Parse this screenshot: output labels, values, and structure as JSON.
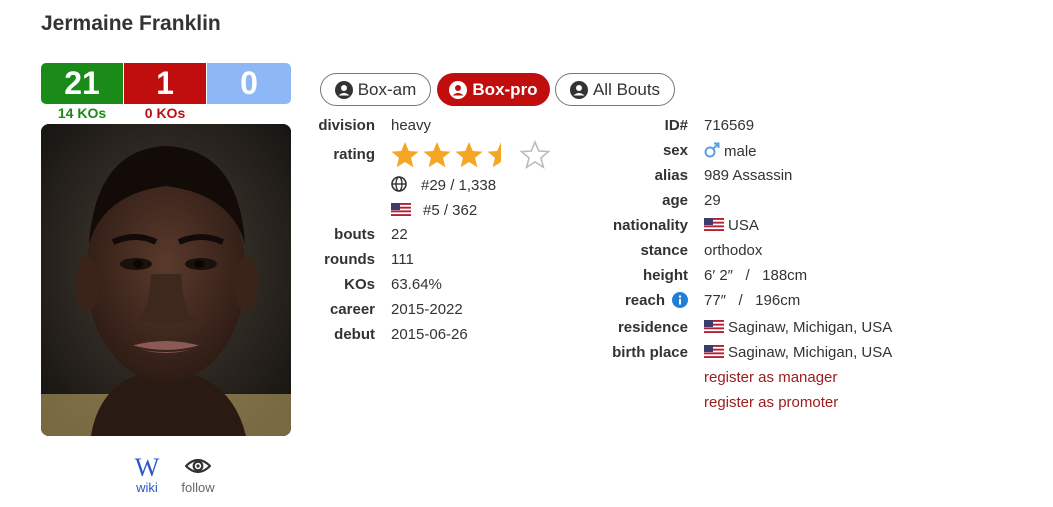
{
  "boxer": {
    "name": "Jermaine Franklin",
    "record": {
      "wins": "21",
      "losses": "1",
      "draws": "0",
      "win_kos": "14 KOs",
      "loss_kos": "0 KOs"
    },
    "rating_stars": 3.5
  },
  "links": {
    "wiki": "wiki",
    "follow": "follow",
    "wiki_glyph": "W"
  },
  "tabs": [
    {
      "label": "Box-am",
      "active": false
    },
    {
      "label": "Box-pro",
      "active": true
    },
    {
      "label": "All Bouts",
      "active": false
    }
  ],
  "left_info": {
    "division": {
      "label": "division",
      "value": "heavy"
    },
    "rating": {
      "label": "rating"
    },
    "world_rank": "#29 / 1,338",
    "country_rank": "#5 / 362",
    "bouts": {
      "label": "bouts",
      "value": "22"
    },
    "rounds": {
      "label": "rounds",
      "value": "111"
    },
    "kos": {
      "label": "KOs",
      "value": "63.64%"
    },
    "career": {
      "label": "career",
      "value": "2015-2022"
    },
    "debut": {
      "label": "debut",
      "value": "2015-06-26"
    }
  },
  "right_info": {
    "id": {
      "label": "ID#",
      "value": "716569"
    },
    "sex": {
      "label": "sex",
      "value": "male"
    },
    "alias": {
      "label": "alias",
      "value": "989 Assassin"
    },
    "age": {
      "label": "age",
      "value": "29"
    },
    "nationality": {
      "label": "nationality",
      "value": "USA"
    },
    "stance": {
      "label": "stance",
      "value": "orthodox"
    },
    "height": {
      "label": "height",
      "value": "6′ 2″   /   188cm"
    },
    "reach": {
      "label": "reach",
      "value": "77″   /   196cm"
    },
    "residence": {
      "label": "residence",
      "value": "Saginaw, Michigan, USA"
    },
    "birth_place": {
      "label": "birth place",
      "value": "Saginaw, Michigan, USA"
    },
    "register_manager": "register as manager",
    "register_promoter": "register as promoter"
  },
  "colors": {
    "win": "#1a8a18",
    "loss": "#c00e0e",
    "draw": "#8db8f5",
    "star": "#f5a623",
    "link": "#9b1b1b"
  }
}
